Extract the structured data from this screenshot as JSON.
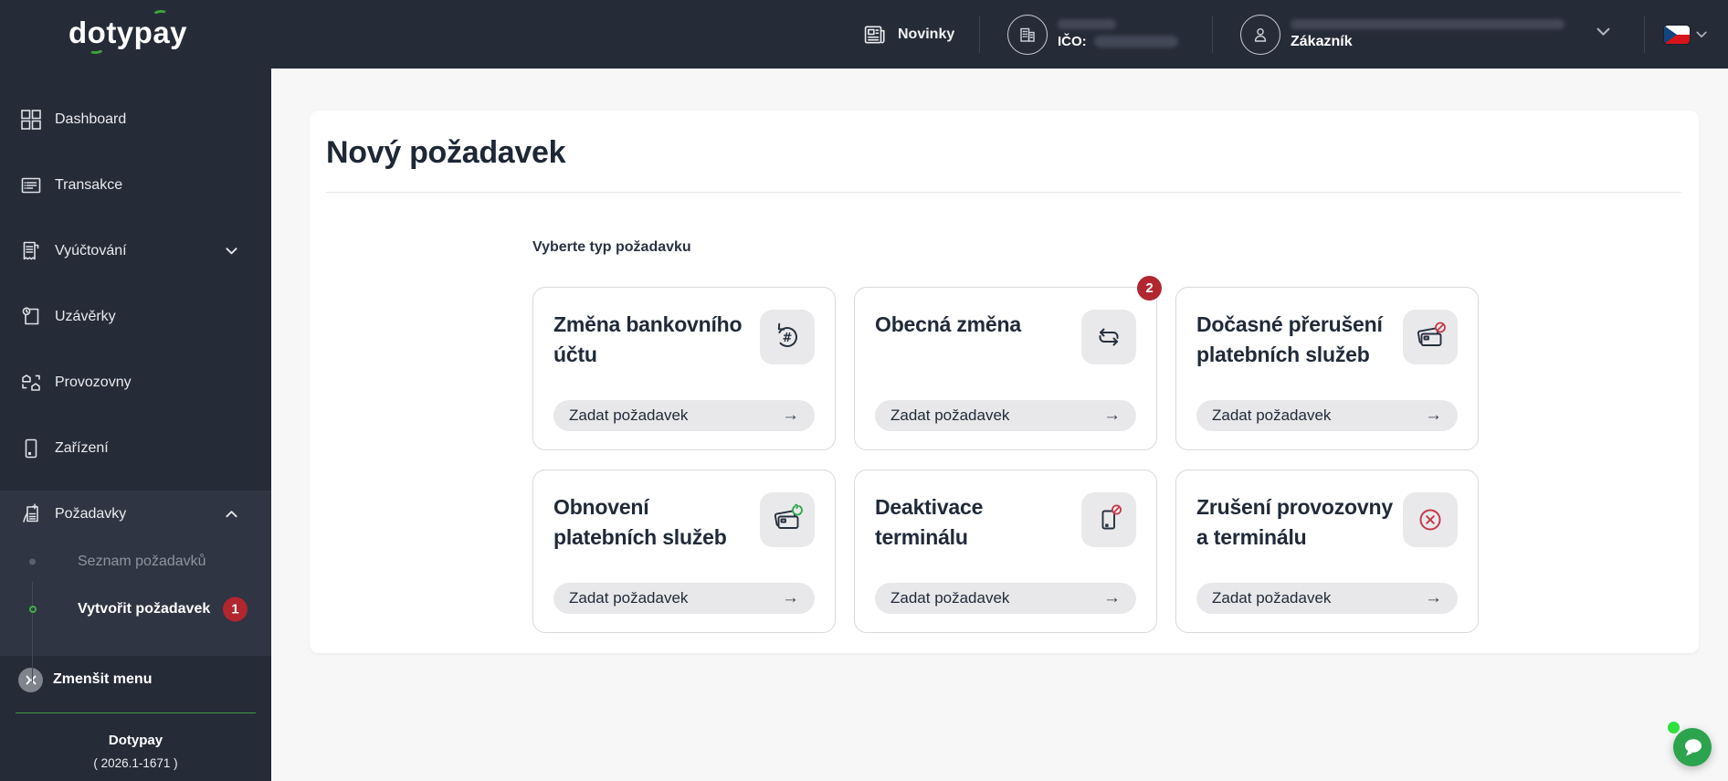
{
  "topbar": {
    "logo": "dotypay",
    "news_label": "Novinky",
    "company": {
      "ico_label": "IČO:"
    },
    "customer": {
      "role_label": "Zákazník"
    }
  },
  "sidebar": {
    "items": [
      {
        "label": "Dashboard",
        "icon": "dashboard-icon"
      },
      {
        "label": "Transakce",
        "icon": "transactions-icon"
      },
      {
        "label": "Vyúčtování",
        "icon": "billing-icon",
        "chevron": "down"
      },
      {
        "label": "Uzávěrky",
        "icon": "closures-icon"
      },
      {
        "label": "Provozovny",
        "icon": "stores-icon"
      },
      {
        "label": "Zařízení",
        "icon": "devices-icon"
      },
      {
        "label": "Požadavky",
        "icon": "requests-icon",
        "chevron": "up"
      }
    ],
    "submenu": [
      {
        "label": "Seznam požadavků",
        "active": false
      },
      {
        "label": "Vytvořit požadavek",
        "active": true,
        "badge": "1"
      }
    ],
    "collapse_label": "Zmenšit menu",
    "footer": {
      "brand": "Dotypay",
      "version": "( 2026.1-1671 )"
    }
  },
  "main": {
    "title": "Nový požadavek",
    "subtitle": "Vyberte typ požadavku",
    "cards": [
      {
        "title": "Změna bankovního účtu",
        "icon": "bank-change-icon",
        "button": "Zadat požadavek"
      },
      {
        "title": "Obecná změna",
        "icon": "general-change-icon",
        "badge": "2",
        "button": "Zadat požadavek"
      },
      {
        "title": "Dočasné přerušení platebních služeb",
        "icon": "card-suspend-icon",
        "button": "Zadat požadavek"
      },
      {
        "title": "Obnovení platebních služeb",
        "icon": "card-renew-icon",
        "button": "Zadat požadavek"
      },
      {
        "title": "Deaktivace terminálu",
        "icon": "terminal-deactivate-icon",
        "button": "Zadat požadavek"
      },
      {
        "title": "Zrušení provozovny a terminálu",
        "icon": "cancel-icon",
        "button": "Zadat požadavek"
      }
    ]
  },
  "colors": {
    "topbar_bg": "#262b38",
    "sidebar_active_bg": "#2f3542",
    "accent_green": "#3da639",
    "badge_red": "#b1262f",
    "chat_green": "#2ca34d",
    "danger_red": "#c6394a"
  }
}
